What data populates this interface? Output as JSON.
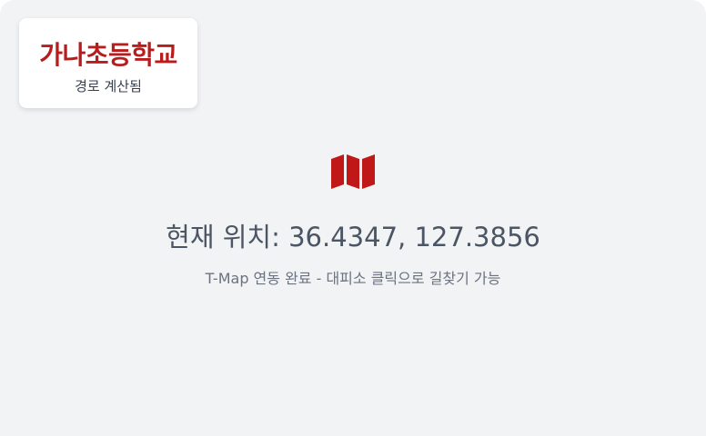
{
  "destination": {
    "name": "가나초등학교",
    "status": "경로 계산됨"
  },
  "location": {
    "label": "현재 위치:",
    "latitude": "36.4347",
    "longitude": "127.3856"
  },
  "tmap": {
    "status": "T-Map 연동 완료 - 대피소 클릭으로 길찾기 가능"
  },
  "icons": {
    "map": "map-icon"
  },
  "colors": {
    "accent": "#b91c1c",
    "background": "#f2f3f5",
    "card": "#ffffff",
    "text_primary": "#4b5563",
    "text_secondary": "#6b7280"
  }
}
